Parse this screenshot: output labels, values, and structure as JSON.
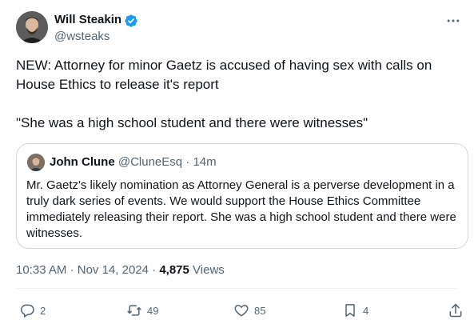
{
  "author": {
    "name": "Will Steakin",
    "handle": "@wsteaks",
    "verified": true
  },
  "tweet": {
    "paragraphs": [
      "NEW: Attorney for minor Gaetz is accused of having sex with calls on House Ethics to release it's report",
      "\"She was a high school student and there were witnesses\""
    ]
  },
  "quote": {
    "name": "John Clune",
    "handle": "@CluneEsq",
    "separator": "·",
    "age": "14m",
    "text": "Mr. Gaetz's likely nomination as Attorney General is a perverse development in a truly dark series of events. We would support the House Ethics Committee immediately releasing their report. She was a high school student and there were witnesses."
  },
  "meta": {
    "time": "10:33 AM",
    "separator": "·",
    "date": "Nov 14, 2024",
    "views_count": "4,875",
    "views_label": "Views"
  },
  "actions": {
    "replies": "2",
    "reposts": "49",
    "likes": "85",
    "bookmarks": "4"
  },
  "icons": {
    "verified": "verified-badge-icon",
    "more": "more-horizontal-icon",
    "reply": "reply-icon",
    "repost": "repost-icon",
    "like": "heart-icon",
    "bookmark": "bookmark-icon",
    "share": "share-icon"
  },
  "colors": {
    "text": "#0f1419",
    "secondary": "#536471",
    "verified": "#1d9bf0",
    "border": "#cfd9de"
  }
}
